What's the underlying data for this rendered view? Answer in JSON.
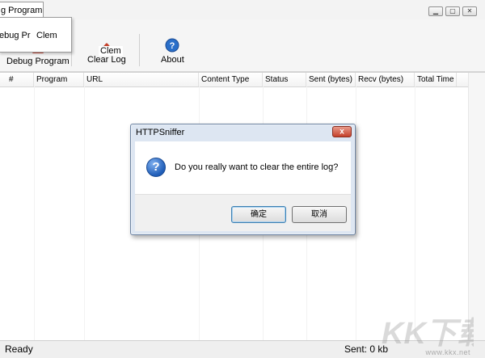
{
  "window": {
    "controls": {
      "minimize": "▁",
      "maximize": "▢",
      "close": "✕"
    }
  },
  "menu": {
    "tab_label": "g Program",
    "items": [
      "ebug Pr",
      "Clem"
    ]
  },
  "ribbon": {
    "floating_label": "Clem",
    "buttons": [
      {
        "label": "Debug Program",
        "icon": "debug-program-icon"
      },
      {
        "label": "Clear Log",
        "icon": "clear-log-icon"
      },
      {
        "label": "About",
        "icon": "help-icon"
      }
    ]
  },
  "list": {
    "columns": [
      "#",
      "Program",
      "URL",
      "Content Type",
      "Status",
      "Sent (bytes)",
      "Recv (bytes)",
      "Total Time"
    ]
  },
  "status": {
    "left": "Ready",
    "right": "Sent: 0 kb"
  },
  "dialog": {
    "title": "HTTPSniffer",
    "close_glyph": "x",
    "icon_glyph": "?",
    "message": "Do you really want to clear the entire log?",
    "ok_label": "确定",
    "cancel_label": "取消"
  },
  "watermark": {
    "text": "KK下载",
    "url": "www.kkx.net"
  },
  "colors": {
    "accent_red": "#c4402a",
    "dialog_frame": "#dde6f2",
    "question_blue": "#1f5db8"
  }
}
